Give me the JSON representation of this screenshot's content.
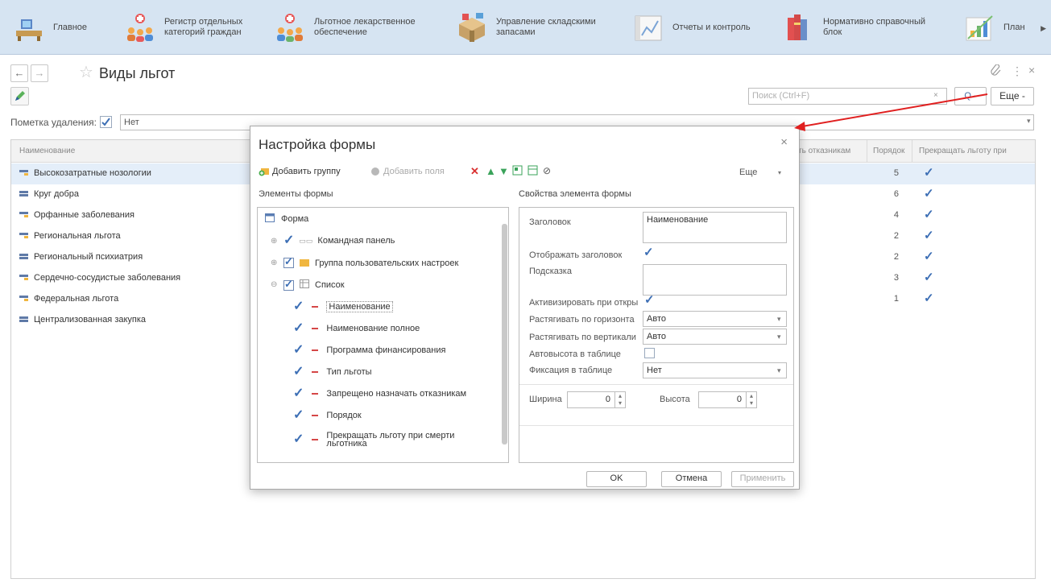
{
  "sections": [
    {
      "label": "Главное",
      "icon": "desk-icon"
    },
    {
      "label": "Регистр отдельных\nкатегорий граждан",
      "icon": "people-icon"
    },
    {
      "label": "Льготное лекарственное\nобеспечение",
      "icon": "people-medical-icon"
    },
    {
      "label": "Управление складскими\nзапасами",
      "icon": "warehouse-icon"
    },
    {
      "label": "Отчеты и контроль",
      "icon": "reports-icon"
    },
    {
      "label": "Нормативно справочный\nблок",
      "icon": "books-icon"
    },
    {
      "label": "План",
      "icon": "chart-icon"
    }
  ],
  "header": {
    "back": "←",
    "forward": "→",
    "title": "Виды льгот",
    "link_icon": "🔗",
    "menu_icon": "⋮",
    "close_icon": "×"
  },
  "toolbar": {
    "search_placeholder": "Поиск (Ctrl+F)",
    "search_clear": "×",
    "search_btn": "Q -",
    "more": "Еще -"
  },
  "filter": {
    "label": "Пометка удаления:",
    "value": "Нет",
    "checked": true
  },
  "table": {
    "columns": [
      "Наименование",
      "ть отказникам",
      "Порядок",
      "Прекращать льготу при"
    ],
    "rows": [
      {
        "name": "Высокозатратные нозологии",
        "order": "5",
        "stop": "✓",
        "folder": true
      },
      {
        "name": "Круг добра",
        "order": "6",
        "stop": "✓",
        "folder": false
      },
      {
        "name": "Орфанные заболевания",
        "order": "4",
        "stop": "✓",
        "folder": true
      },
      {
        "name": "Региональная льгота",
        "order": "2",
        "stop": "✓",
        "folder": true
      },
      {
        "name": "Региональный психиатрия",
        "order": "2",
        "stop": "✓",
        "folder": false
      },
      {
        "name": "Сердечно-сосудистые заболевания",
        "order": "3",
        "stop": "✓",
        "folder": true
      },
      {
        "name": "Федеральная льгота",
        "order": "1",
        "stop": "✓",
        "folder": true
      },
      {
        "name": "Централизованная закупка",
        "order": "",
        "stop": "",
        "folder": false
      }
    ]
  },
  "modal": {
    "title": "Настройка формы",
    "close": "×",
    "add_group": "Добавить группу",
    "add_field": "Добавить поля",
    "more": "Еще",
    "left_title": "Элементы формы",
    "right_title": "Свойства элемента формы",
    "tree": {
      "root": "Форма",
      "command_panel": "Командная панель",
      "user_settings_group": "Группа пользовательских настроек",
      "list": "Список",
      "items": [
        "Наименование",
        "Наименование полное",
        "Программа финансирования",
        "Тип льготы",
        "Запрещено назначать отказникам",
        "Порядок",
        "Прекращать льготу при смерти\nльготника"
      ]
    },
    "props": {
      "caption_label": "Заголовок",
      "caption_value": "Наименование",
      "show_caption_label": "Отображать заголовок",
      "hint_label": "Подсказка",
      "activate_label": "Активизировать при откры",
      "stretch_h_label": "Растягивать по горизонта",
      "stretch_h_value": "Авто",
      "stretch_v_label": "Растягивать по вертикали",
      "stretch_v_value": "Авто",
      "autoheight_label": "Автовысота в таблице",
      "fix_label": "Фиксация в таблице",
      "fix_value": "Нет",
      "width_label": "Ширина",
      "width_value": "0",
      "height_label": "Высота",
      "height_value": "0"
    },
    "ok": "OK",
    "cancel": "Отмена",
    "apply": "Применить"
  },
  "colors": {
    "accent": "#3d6fb5",
    "topbar": "#d6e4f2",
    "arrow": "#e02020"
  }
}
